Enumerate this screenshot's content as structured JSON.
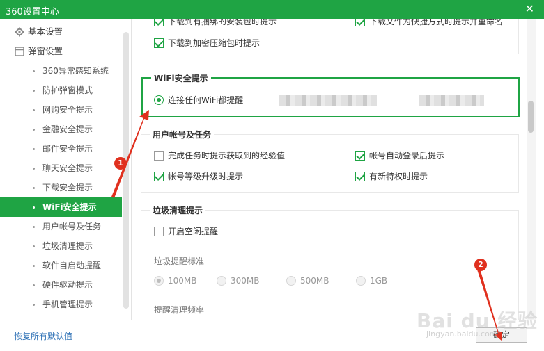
{
  "window": {
    "title": "360设置中心",
    "close_glyph": "✕"
  },
  "sidebar": {
    "categories": [
      {
        "label": "基本设置",
        "icon": "gear-icon"
      },
      {
        "label": "弹窗设置",
        "icon": "window-icon"
      }
    ],
    "items": [
      {
        "label": "360异常感知系统",
        "active": false
      },
      {
        "label": "防护弹窗模式",
        "active": false
      },
      {
        "label": "网购安全提示",
        "active": false
      },
      {
        "label": "金融安全提示",
        "active": false
      },
      {
        "label": "邮件安全提示",
        "active": false
      },
      {
        "label": "聊天安全提示",
        "active": false
      },
      {
        "label": "下载安全提示",
        "active": false
      },
      {
        "label": "WiFi安全提示",
        "active": true
      },
      {
        "label": "用户帐号及任务",
        "active": false
      },
      {
        "label": "垃圾清理提示",
        "active": false
      },
      {
        "label": "软件自启动提醒",
        "active": false
      },
      {
        "label": "硬件驱动提示",
        "active": false
      },
      {
        "label": "手机管理提示",
        "active": false
      }
    ]
  },
  "main": {
    "download": {
      "cut_left": "下载到有捆绑的安装包时提示",
      "cut_right": "下载文件为快捷方式时提示并重命名",
      "compressed": "下载到加密压缩包时提示"
    },
    "wifi": {
      "title": "WiFi安全提示",
      "option": "连接任何WiFi都提醒",
      "checked": true
    },
    "account": {
      "title": "用户帐号及任务",
      "options": [
        {
          "label": "完成任务时提示获取到的经验值",
          "checked": false
        },
        {
          "label": "帐号自动登录后提示",
          "checked": true
        },
        {
          "label": "帐号等级升级时提示",
          "checked": true
        },
        {
          "label": "有新特权时提示",
          "checked": true
        }
      ]
    },
    "garbage": {
      "title": "垃圾清理提示",
      "idle_option": "开启空闲提醒",
      "idle_checked": false,
      "standard_label": "垃圾提醒标准",
      "sizes": [
        {
          "label": "100MB",
          "selected": true
        },
        {
          "label": "300MB",
          "selected": false
        },
        {
          "label": "500MB",
          "selected": false
        },
        {
          "label": "1GB",
          "selected": false
        }
      ],
      "frequency_label": "提醒清理频率"
    }
  },
  "footer": {
    "reset_label": "恢复所有默认值",
    "ok_label": "确定"
  },
  "annotations": {
    "badge1": "1",
    "badge2": "2",
    "arrow_color": "#e0301e"
  },
  "watermark": {
    "main": "Bai du 经验",
    "sub": "jingyan.baidu.com"
  },
  "colors": {
    "accent": "#1fa444",
    "link": "#2b6fb5"
  }
}
